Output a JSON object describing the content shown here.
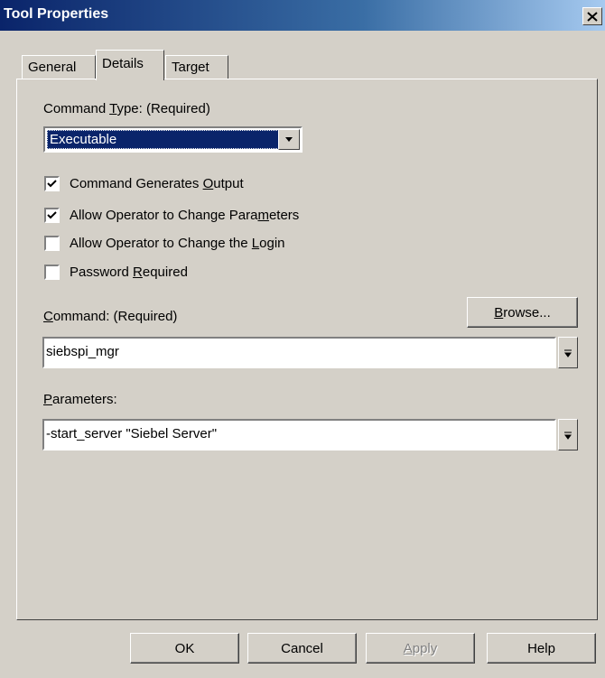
{
  "window": {
    "title": "Tool Properties"
  },
  "tabs": [
    {
      "label": "General"
    },
    {
      "label": "Details"
    },
    {
      "label": "Target"
    }
  ],
  "command_type": {
    "label_pre": "Command ",
    "label_accel": "T",
    "label_post": "ype: (Required)",
    "selected_value": "Executable"
  },
  "checkboxes": [
    {
      "pre": "Command Generates ",
      "accel": "O",
      "post": "utput",
      "checked": true
    },
    {
      "pre": "Allow Operator to Change Para",
      "accel": "m",
      "post": "eters",
      "checked": true
    },
    {
      "pre": "Allow Operator to Change the ",
      "accel": "L",
      "post": "ogin",
      "checked": false
    },
    {
      "pre": "Password ",
      "accel": "R",
      "post": "equired",
      "checked": false
    }
  ],
  "command": {
    "label_accel": "C",
    "label_post": "ommand: (Required)",
    "value": "siebspi_mgr",
    "browse_accel": "B",
    "browse_post": "rowse..."
  },
  "parameters": {
    "label_accel": "P",
    "label_post": "arameters:",
    "value": "-start_server \"Siebel Server\""
  },
  "footer": {
    "ok": "OK",
    "cancel": "Cancel",
    "apply_accel": "A",
    "apply_post": "pply",
    "help": "Help"
  }
}
